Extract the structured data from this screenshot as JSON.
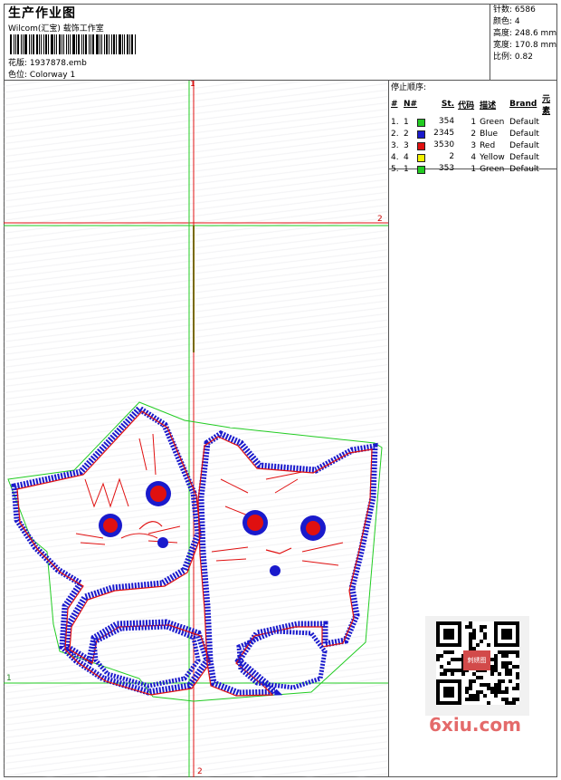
{
  "header": {
    "title": "生产作业图",
    "studio": "Wilcom(汇宝) 载饰工作室",
    "design_label": "花版:",
    "design_value": "1937878.emb",
    "colorway_label": "色位:",
    "colorway_value": "Colorway 1"
  },
  "stats": {
    "stitches_label": "针数:",
    "stitches_value": "6586",
    "colors_label": "颜色:",
    "colors_value": "4",
    "height_label": "高度:",
    "height_value": "248.6 mm",
    "width_label": "宽度:",
    "width_value": "170.8 mm",
    "scale_label": "比例:",
    "scale_value": "0.82"
  },
  "stop_sequence": {
    "title": "停止顺序:",
    "columns": [
      "#",
      "N#",
      "St.",
      "代码",
      "描述",
      "Brand",
      "元素"
    ],
    "rows": [
      {
        "idx": "1.",
        "n": "1",
        "color": "#22cc22",
        "st": "354",
        "code": "1",
        "desc": "Green",
        "brand": "Default"
      },
      {
        "idx": "2.",
        "n": "2",
        "color": "#1a1acc",
        "st": "2345",
        "code": "2",
        "desc": "Blue",
        "brand": "Default"
      },
      {
        "idx": "3.",
        "n": "3",
        "color": "#e01010",
        "st": "3530",
        "code": "3",
        "desc": "Red",
        "brand": "Default"
      },
      {
        "idx": "4.",
        "n": "4",
        "color": "#f2f200",
        "st": "2",
        "code": "4",
        "desc": "Yellow",
        "brand": "Default"
      },
      {
        "idx": "5.",
        "n": "1",
        "color": "#22cc22",
        "st": "353",
        "code": "1",
        "desc": "Green",
        "brand": "Default"
      }
    ]
  },
  "canvas": {
    "markers": [
      "1",
      "2",
      "1",
      "2"
    ]
  },
  "watermark": {
    "logo": "6xiu.com",
    "qr_badge": "刺绣图"
  },
  "colors": {
    "green": "#22cc22",
    "blue": "#1a1acc",
    "red": "#e01010",
    "yellow": "#f2f200"
  }
}
